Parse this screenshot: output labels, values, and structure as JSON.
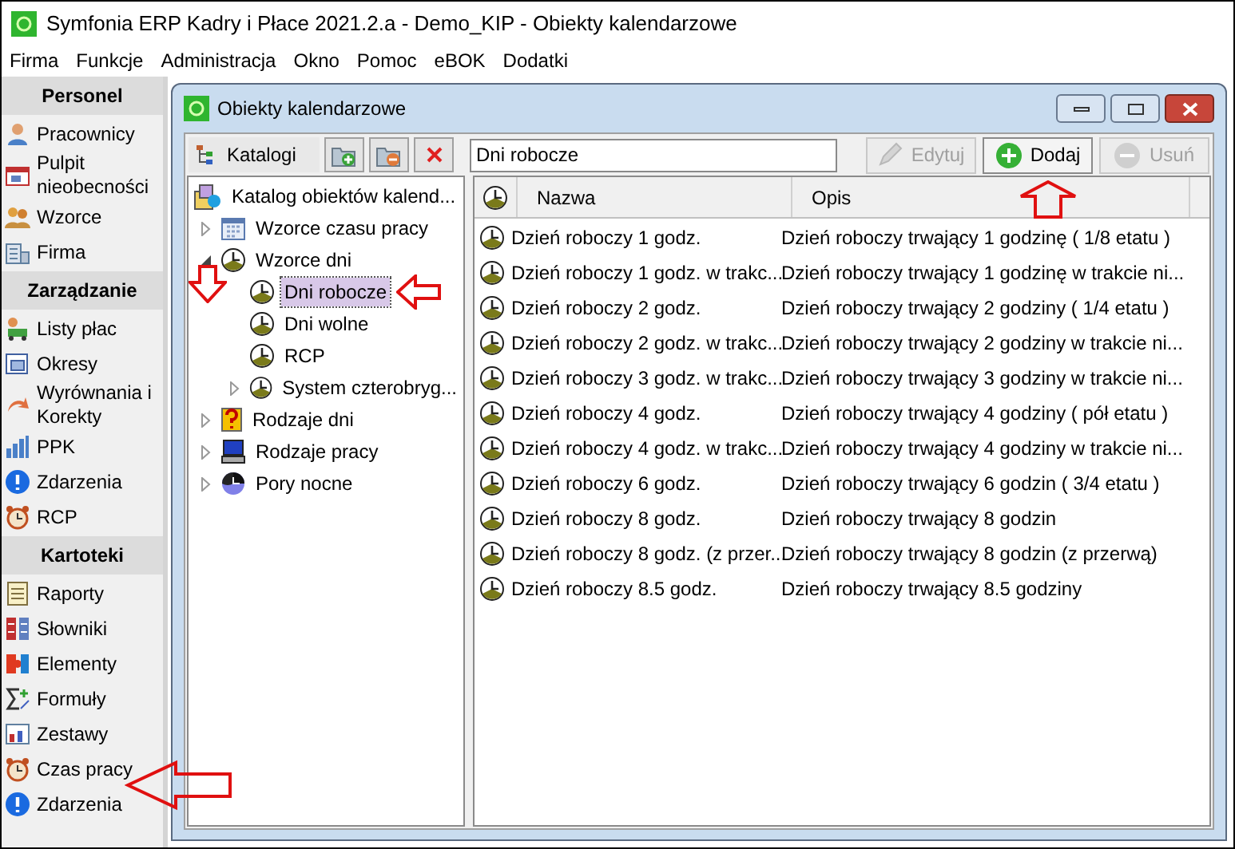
{
  "window": {
    "title": "Symfonia ERP Kadry i Płace 2021.2.a - Demo_KIP - Obiekty kalendarzowe"
  },
  "menu": [
    "Firma",
    "Funkcje",
    "Administracja",
    "Okno",
    "Pomoc",
    "eBOK",
    "Dodatki"
  ],
  "sidebar": {
    "sections": [
      {
        "title": "Personel",
        "items": [
          {
            "label": "Pracownicy",
            "kind": "person"
          },
          {
            "label": "Pulpit nieobecności",
            "kind": "calendar"
          },
          {
            "label": "Wzorce",
            "kind": "people"
          },
          {
            "label": "Firma",
            "kind": "building"
          }
        ]
      },
      {
        "title": "Zarządzanie",
        "items": [
          {
            "label": "Listy płac",
            "kind": "payroll"
          },
          {
            "label": "Okresy",
            "kind": "window"
          },
          {
            "label": "Wyrównania i Korekty",
            "kind": "return"
          },
          {
            "label": "PPK",
            "kind": "bars"
          },
          {
            "label": "Zdarzenia",
            "kind": "info"
          },
          {
            "label": "RCP",
            "kind": "alarm"
          }
        ]
      },
      {
        "title": "Kartoteki",
        "items": [
          {
            "label": "Raporty",
            "kind": "report"
          },
          {
            "label": "Słowniki",
            "kind": "dict"
          },
          {
            "label": "Elementy",
            "kind": "puzzle"
          },
          {
            "label": "Formuły",
            "kind": "sigma"
          },
          {
            "label": "Zestawy",
            "kind": "chart"
          },
          {
            "label": "Czas pracy",
            "kind": "alarm"
          },
          {
            "label": "Zdarzenia",
            "kind": "info"
          }
        ]
      }
    ]
  },
  "child_window": {
    "title": "Obiekty kalendarzowe",
    "catalog_button": "Katalogi",
    "tree": {
      "label": "Katalog obiektów kalend...",
      "kind": "catalog",
      "selected": false,
      "children": [
        {
          "label": "Wzorce czasu pracy",
          "kind": "calendar",
          "expanded": false,
          "selected": false
        },
        {
          "label": "Wzorce dni",
          "kind": "clock",
          "expanded": true,
          "selected": false,
          "children": [
            {
              "label": "Dni robocze",
              "kind": "clock",
              "selected": true
            },
            {
              "label": "Dni wolne",
              "kind": "clock",
              "selected": false
            },
            {
              "label": "RCP",
              "kind": "clock",
              "selected": false
            },
            {
              "label": "System czterobryg...",
              "kind": "clock",
              "expanded": false,
              "selected": false
            }
          ]
        },
        {
          "label": "Rodzaje dni",
          "kind": "question",
          "expanded": false,
          "selected": false
        },
        {
          "label": "Rodzaje pracy",
          "kind": "computer",
          "expanded": false,
          "selected": false
        },
        {
          "label": "Pory nocne",
          "kind": "night",
          "expanded": false,
          "selected": false
        }
      ]
    },
    "name_field": {
      "value": "Dni robocze"
    },
    "buttons": [
      {
        "label": "Edytuj",
        "kind": "edit",
        "disabled": true
      },
      {
        "label": "Dodaj",
        "kind": "add",
        "disabled": false
      },
      {
        "label": "Usuń",
        "kind": "remove",
        "disabled": true
      }
    ],
    "table": {
      "columns": [
        "Nazwa",
        "Opis"
      ],
      "rows": [
        [
          "Dzień roboczy 1 godz.",
          "Dzień roboczy trwający 1 godzinę ( 1/8 etatu )"
        ],
        [
          "Dzień roboczy 1 godz. w trakc...",
          "Dzień roboczy trwający 1 godzinę w trakcie ni..."
        ],
        [
          "Dzień roboczy 2 godz.",
          "Dzień roboczy trwający 2 godziny ( 1/4 etatu )"
        ],
        [
          "Dzień roboczy 2 godz. w trakc...",
          "Dzień roboczy trwający 2 godziny w trakcie ni..."
        ],
        [
          "Dzień roboczy 3 godz. w trakc...",
          "Dzień roboczy trwający 3 godziny w trakcie ni..."
        ],
        [
          "Dzień roboczy 4 godz.",
          "Dzień roboczy trwający 4 godziny ( pół etatu )"
        ],
        [
          "Dzień roboczy 4 godz. w trakc...",
          "Dzień roboczy trwający 4 godziny w trakcie ni..."
        ],
        [
          "Dzień roboczy 6 godz.",
          "Dzień roboczy trwający 6 godzin ( 3/4 etatu )"
        ],
        [
          "Dzień roboczy 8 godz.",
          "Dzień roboczy trwający 8 godzin"
        ],
        [
          "Dzień roboczy 8 godz. (z przer...",
          "Dzień roboczy trwający 8 godzin (z przerwą)"
        ],
        [
          "Dzień roboczy 8.5 godz.",
          "Dzień roboczy trwający 8.5 godziny"
        ]
      ]
    }
  }
}
